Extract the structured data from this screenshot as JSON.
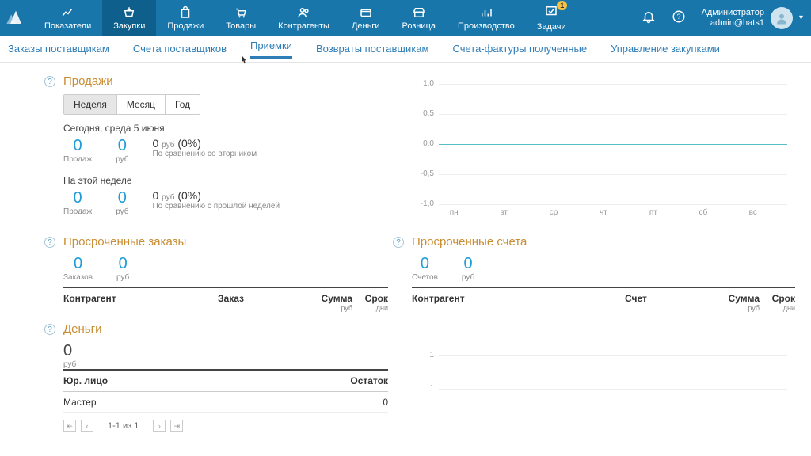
{
  "nav": [
    {
      "label": "Показатели"
    },
    {
      "label": "Закупки"
    },
    {
      "label": "Продажи"
    },
    {
      "label": "Товары"
    },
    {
      "label": "Контрагенты"
    },
    {
      "label": "Деньги"
    },
    {
      "label": "Розница"
    },
    {
      "label": "Производство"
    },
    {
      "label": "Задачи",
      "badge": "1"
    }
  ],
  "user": {
    "name": "Администратор",
    "login": "admin@hats1"
  },
  "submenu": [
    "Заказы поставщикам",
    "Счета поставщиков",
    "Приемки",
    "Возвраты поставщикам",
    "Счета-фактуры полученные",
    "Управление закупками"
  ],
  "sales": {
    "title": "Продажи",
    "seg": [
      "Неделя",
      "Месяц",
      "Год"
    ],
    "today": {
      "caption": "Сегодня, среда 5 июня",
      "count": "0",
      "count_lbl": "Продаж",
      "sum": "0",
      "sum_lbl": "руб",
      "cmp_val": "0",
      "cmp_cur": "руб",
      "cmp_pct": "(0%)",
      "cmp_lbl": "По сравнению со вторником"
    },
    "week": {
      "caption": "На этой неделе",
      "count": "0",
      "count_lbl": "Продаж",
      "sum": "0",
      "sum_lbl": "руб",
      "cmp_val": "0",
      "cmp_cur": "руб",
      "cmp_pct": "(0%)",
      "cmp_lbl": "По сравнению с прошлой неделей"
    }
  },
  "chart_data": {
    "type": "line",
    "categories": [
      "пн",
      "вт",
      "ср",
      "чт",
      "пт",
      "сб",
      "вс"
    ],
    "values": [
      0,
      0,
      0,
      0,
      0,
      0,
      0
    ],
    "ylim": [
      -1.0,
      1.0
    ],
    "yticks": [
      "1,0",
      "0,5",
      "0,0",
      "-0,5",
      "-1,0"
    ]
  },
  "overdue_orders": {
    "title": "Просроченные заказы",
    "count": "0",
    "count_lbl": "Заказов",
    "sum": "0",
    "sum_lbl": "руб",
    "cols": {
      "c1": "Контрагент",
      "c2": "Заказ",
      "c3": "Сумма",
      "c3s": "руб",
      "c4": "Срок",
      "c4s": "дни"
    }
  },
  "overdue_bills": {
    "title": "Просроченные счета",
    "count": "0",
    "count_lbl": "Счетов",
    "sum": "0",
    "sum_lbl": "руб",
    "cols": {
      "c1": "Контрагент",
      "c2": "Счет",
      "c3": "Сумма",
      "c3s": "руб",
      "c4": "Срок",
      "c4s": "дни"
    }
  },
  "money": {
    "title": "Деньги",
    "value": "0",
    "cur": "руб",
    "cols": {
      "c1": "Юр. лицо",
      "c2": "Остаток"
    },
    "rows": [
      {
        "name": "Мастер",
        "balance": "0"
      }
    ],
    "pager": "1-1 из 1"
  },
  "chart2": {
    "yticks": [
      "1",
      "1"
    ]
  }
}
